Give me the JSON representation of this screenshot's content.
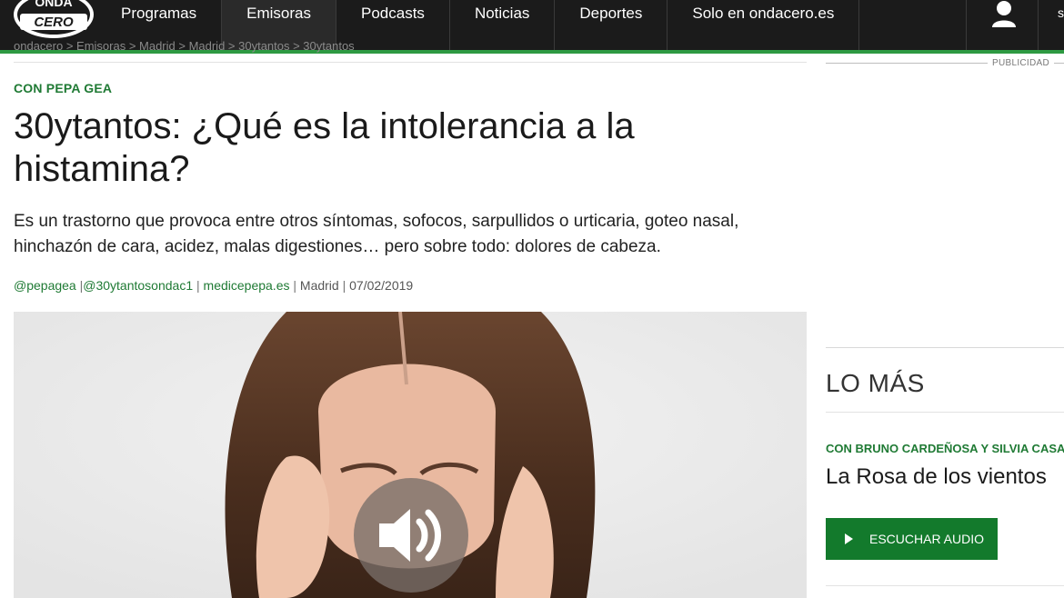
{
  "nav": {
    "logo_top": "ONDA",
    "logo_bottom": "CERO",
    "items": [
      "Programas",
      "Emisoras",
      "Podcasts",
      "Noticias",
      "Deportes",
      "Solo en ondacero.es"
    ],
    "active_index": 1,
    "edge_letter": "s"
  },
  "breadcrumb": "ondacero > Emisoras > Madrid > Madrid > 30ytantos > 30ytantos",
  "article": {
    "kicker": "CON PEPA GEA",
    "headline": "30ytantos: ¿Qué es la intolerancia a la histamina?",
    "subtitle": "Es un trastorno que provoca entre otros síntomas, sofocos, sarpullidos o urticaria, goteo nasal, hinchazón de cara, acidez, malas digestiones… pero sobre todo: dolores de cabeza.",
    "meta": {
      "author1": "@pepagea",
      "author2": "@30ytantosondac1",
      "author3": "medicepepa.es",
      "location": "Madrid",
      "date": "07/02/2019"
    }
  },
  "sidebar": {
    "ad_label": "PUBLICIDAD",
    "section_title": "LO MÁS",
    "kicker": "CON BRUNO CARDEÑOSA Y SILVIA CASA",
    "title": "La Rosa de los vientos",
    "listen_label": "ESCUCHAR AUDIO"
  },
  "colors": {
    "brand_green": "#1f7a34",
    "button_green": "#137a2c",
    "nav_bg": "#1b1b1b"
  }
}
